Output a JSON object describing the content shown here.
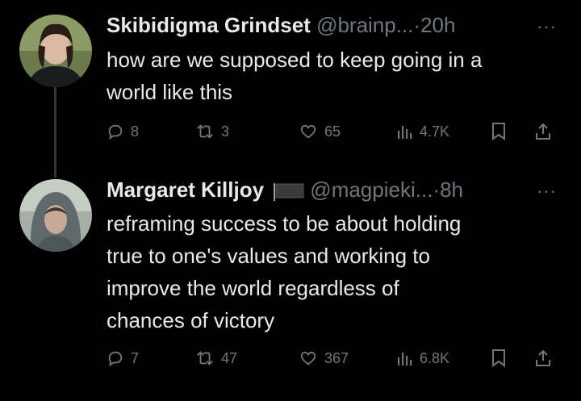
{
  "tweets": [
    {
      "name": "Skibidigma Grindset",
      "handle": "@brainp...",
      "separator": "·",
      "time": "20h",
      "more": "···",
      "text_lines": [
        "how are we supposed to keep going in a",
        "world like this"
      ],
      "replies": "8",
      "retweets": "3",
      "likes": "65",
      "views": "4.7K"
    },
    {
      "name": "Margaret Killjoy",
      "handle": "@magpieki...",
      "separator": "·",
      "time": "8h",
      "more": "···",
      "text_lines": [
        "reframing success to be about holding",
        "true to one's values and working to",
        "improve the world regardless of",
        "chances of victory"
      ],
      "replies": "7",
      "retweets": "47",
      "likes": "367",
      "views": "6.8K"
    }
  ],
  "icons": {
    "reply": "reply-icon",
    "retweet": "retweet-icon",
    "like": "heart-icon",
    "views": "views-icon",
    "bookmark": "bookmark-icon",
    "share": "share-icon"
  },
  "colors": {
    "background": "#000000",
    "text": "#e7e9ea",
    "secondary": "#71767b",
    "thread_line": "#333639"
  }
}
